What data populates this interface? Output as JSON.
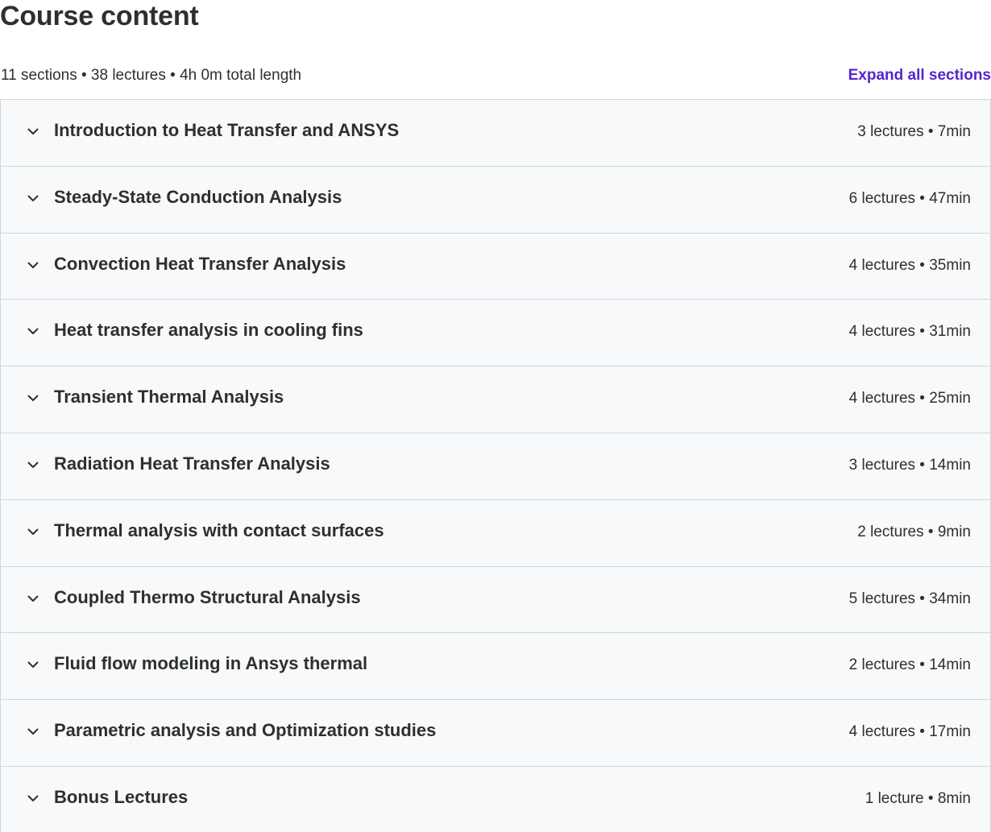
{
  "header": {
    "title": "Course content",
    "summary": "11 sections • 38 lectures • 4h 0m total length",
    "expand_label": "Expand all sections"
  },
  "sections": [
    {
      "title": "Introduction to Heat Transfer and ANSYS",
      "meta": "3 lectures • 7min"
    },
    {
      "title": "Steady-State Conduction Analysis",
      "meta": "6 lectures • 47min"
    },
    {
      "title": "Convection Heat Transfer Analysis",
      "meta": "4 lectures • 35min"
    },
    {
      "title": "Heat transfer analysis in cooling fins",
      "meta": "4 lectures • 31min"
    },
    {
      "title": "Transient Thermal Analysis",
      "meta": "4 lectures • 25min"
    },
    {
      "title": "Radiation Heat Transfer Analysis",
      "meta": "3 lectures • 14min"
    },
    {
      "title": "Thermal analysis with contact surfaces",
      "meta": "2 lectures • 9min"
    },
    {
      "title": "Coupled Thermo Structural Analysis",
      "meta": "5 lectures • 34min"
    },
    {
      "title": "Fluid flow modeling in Ansys thermal",
      "meta": "2 lectures • 14min"
    },
    {
      "title": "Parametric analysis and Optimization studies",
      "meta": "4 lectures • 17min"
    },
    {
      "title": "Bonus Lectures",
      "meta": "1 lecture • 8min"
    }
  ],
  "icons": {
    "section_toggle": "chevron-down-icon"
  },
  "colors": {
    "text": "#2d2f31",
    "accent": "#5624d0",
    "section_bg": "#f7f9fa",
    "border": "#d1d7dc"
  }
}
